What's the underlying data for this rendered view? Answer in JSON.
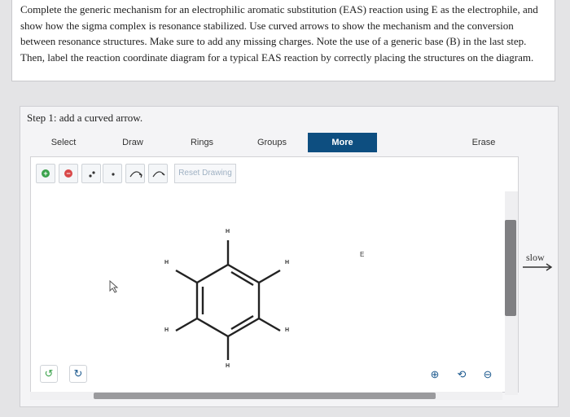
{
  "question": {
    "text": "Complete the generic mechanism for an electrophilic aromatic substitution (EAS) reaction using E as the electrophile, and show how the sigma complex is resonance stabilized. Use curved arrows to show the mechanism and the conversion between resonance structures. Make sure to add any missing charges. Note the use of a generic base (B) in the last step. Then, label the reaction coordinate diagram for a typical EAS reaction by correctly placing the structures on the diagram."
  },
  "step": {
    "title": "Step 1: add a curved arrow."
  },
  "toolbar": {
    "tabs": [
      {
        "label": "Select"
      },
      {
        "label": "Draw"
      },
      {
        "label": "Rings"
      },
      {
        "label": "Groups"
      },
      {
        "label": "More",
        "active": true
      },
      {
        "label": "Erase"
      }
    ],
    "reset_label": "Reset Drawing"
  },
  "molecule": {
    "h_labels": [
      "H",
      "H",
      "H",
      "H",
      "H",
      "H"
    ],
    "electrophile": "E"
  },
  "side": {
    "slow_label": "slow"
  },
  "colors": {
    "active_tab": "#0d4e80",
    "plus_button": "#3aa24b",
    "minus_button": "#d94848",
    "undo_icon": "#3aa24b",
    "redo_icon": "#1d5a8f"
  },
  "icons": [
    "plus-charge-icon",
    "minus-charge-icon",
    "radical-pair-icon",
    "single-electron-icon",
    "curved-arrow-pair-icon",
    "curved-arrow-single-icon",
    "cursor-icon",
    "undo-icon",
    "redo-icon",
    "zoom-in-icon",
    "zoom-reset-icon",
    "zoom-out-icon"
  ]
}
